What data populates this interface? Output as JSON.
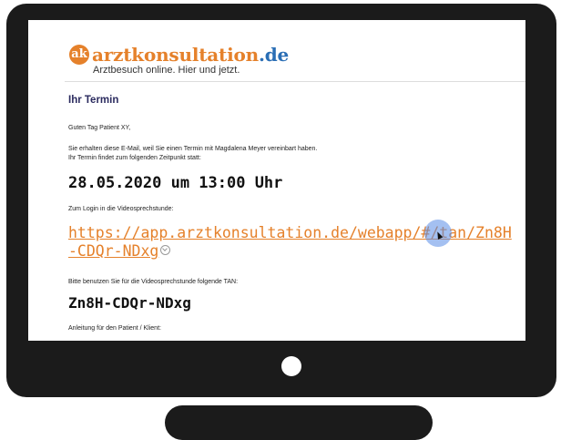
{
  "logo": {
    "badge": "ak",
    "name_part1": "arzt",
    "name_part2": "konsultation",
    "name_part3": ".de",
    "tagline": "Arztbesuch online. Hier und jetzt."
  },
  "email": {
    "heading": "Ihr Termin",
    "greeting": "Guten Tag Patient XY,",
    "body_line1": "Sie erhalten diese E-Mail, weil Sie einen Termin mit Magdalena Meyer vereinbart haben.",
    "body_line2": "Ihr Termin findet zum folgenden Zeitpunkt statt:",
    "appointment": "28.05.2020 um 13:00 Uhr",
    "login_label": "Zum Login in die Videosprechstunde:",
    "login_link": "https://app.arztkonsultation.de/webapp/#/tan/Zn8H-CDQr-NDxg",
    "tan_label": "Bitte benutzen Sie für die Videosprechstunde folgende TAN:",
    "tan": "Zn8H-CDQr-NDxg",
    "instructions_label": "Anleitung für den Patient / Klient:"
  },
  "icons": {
    "link_chevron": "chevron-down-icon",
    "cursor": "cursor-icon",
    "camera": "camera-dot-icon"
  },
  "colors": {
    "brand_orange": "#e5812b",
    "brand_blue": "#2a6eb5",
    "monitor": "#1b1b1b",
    "heading": "#2b2b5f"
  }
}
